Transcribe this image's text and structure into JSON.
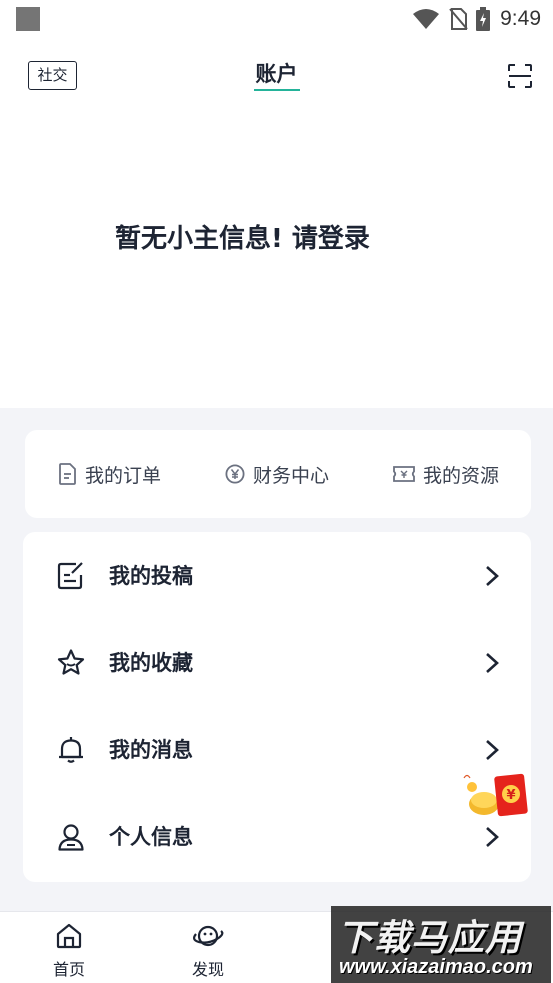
{
  "status_bar": {
    "time": "9:49",
    "icons": [
      "app-square-icon",
      "wifi-icon",
      "no-sim-icon",
      "battery-charging-icon"
    ]
  },
  "header": {
    "social_label": "社交",
    "title": "账户",
    "scan_icon": "scan-icon",
    "accent_color": "#24b39a"
  },
  "login_prompt": "暂无小主信息! 请登录",
  "quick_actions": [
    {
      "label": "我的订单",
      "icon": "order-document-icon"
    },
    {
      "label": "财务中心",
      "icon": "yen-coin-icon"
    },
    {
      "label": "我的资源",
      "icon": "ticket-icon"
    }
  ],
  "menu": [
    {
      "label": "我的投稿",
      "icon": "edit-note-icon"
    },
    {
      "label": "我的收藏",
      "icon": "star-icon"
    },
    {
      "label": "我的消息",
      "icon": "bell-icon"
    },
    {
      "label": "个人信息",
      "icon": "user-icon"
    }
  ],
  "floating_badge": {
    "icon": "red-envelope-icon",
    "symbol": "¥"
  },
  "bottom_nav": [
    {
      "label": "首页",
      "icon": "home-icon"
    },
    {
      "label": "发现",
      "icon": "planet-icon"
    }
  ],
  "watermark": {
    "title": "下载马应用",
    "url": "www.xiazaimao.com"
  }
}
